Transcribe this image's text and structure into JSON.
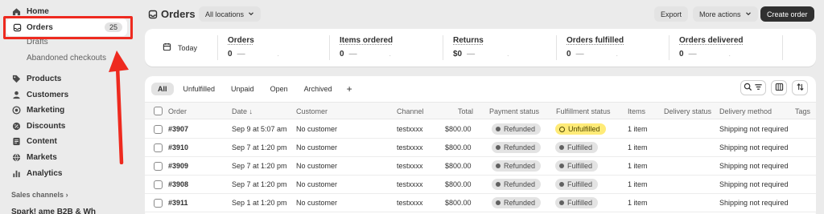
{
  "sidebar": {
    "items": [
      {
        "label": "Home",
        "icon": "home-icon"
      },
      {
        "label": "Orders",
        "icon": "orders-icon",
        "count": "25"
      },
      {
        "label": "Drafts"
      },
      {
        "label": "Abandoned checkouts"
      },
      {
        "label": "Products",
        "icon": "tag-icon"
      },
      {
        "label": "Customers",
        "icon": "person-icon"
      },
      {
        "label": "Marketing",
        "icon": "target-icon"
      },
      {
        "label": "Discounts",
        "icon": "discount-icon"
      },
      {
        "label": "Content",
        "icon": "content-icon"
      },
      {
        "label": "Markets",
        "icon": "globe-icon"
      },
      {
        "label": "Analytics",
        "icon": "chart-bars-icon"
      }
    ],
    "sales_channels_label": "Sales channels",
    "cut_item": "Spark! ame B2B & Wh"
  },
  "header": {
    "title": "Orders",
    "location": "All locations",
    "export_label": "Export",
    "more_actions_label": "More actions",
    "create_label": "Create order"
  },
  "stats": {
    "today": "Today",
    "metrics": [
      {
        "label": "Orders",
        "value": "0"
      },
      {
        "label": "Items ordered",
        "value": "0"
      },
      {
        "label": "Returns",
        "value": "$0"
      },
      {
        "label": "Orders fulfilled",
        "value": "0"
      },
      {
        "label": "Orders delivered",
        "value": "0"
      }
    ]
  },
  "tabs": [
    "All",
    "Unfulfilled",
    "Unpaid",
    "Open",
    "Archived"
  ],
  "table": {
    "columns": [
      "Order",
      "Date",
      "Customer",
      "Channel",
      "Total",
      "Payment status",
      "Fulfillment status",
      "Items",
      "Delivery status",
      "Delivery method",
      "Tags"
    ],
    "rows": [
      {
        "order": "#3907",
        "date": "Sep 9 at 5:07 am",
        "customer": "No customer",
        "channel": "testxxxx",
        "total": "$800.00",
        "payment": "Refunded",
        "fulfillment": "Unfulfilled",
        "items": "1 item",
        "method": "Shipping not required"
      },
      {
        "order": "#3910",
        "date": "Sep 7 at 1:20 pm",
        "customer": "No customer",
        "channel": "testxxxx",
        "total": "$800.00",
        "payment": "Refunded",
        "fulfillment": "Fulfilled",
        "items": "1 item",
        "method": "Shipping not required"
      },
      {
        "order": "#3909",
        "date": "Sep 7 at 1:20 pm",
        "customer": "No customer",
        "channel": "testxxxx",
        "total": "$800.00",
        "payment": "Refunded",
        "fulfillment": "Fulfilled",
        "items": "1 item",
        "method": "Shipping not required"
      },
      {
        "order": "#3908",
        "date": "Sep 7 at 1:20 pm",
        "customer": "No customer",
        "channel": "testxxxx",
        "total": "$800.00",
        "payment": "Refunded",
        "fulfillment": "Fulfilled",
        "items": "1 item",
        "method": "Shipping not required"
      },
      {
        "order": "#3911",
        "date": "Sep 1 at 1:20 pm",
        "customer": "No customer",
        "channel": "testxxxx",
        "total": "$800.00",
        "payment": "Refunded",
        "fulfillment": "Fulfilled",
        "items": "1 item",
        "method": "Shipping not required"
      }
    ]
  },
  "colors": {
    "highlight": "#ee2a1f",
    "primary_button": "#303030",
    "unfulfilled_pill": "#ffeb78"
  }
}
